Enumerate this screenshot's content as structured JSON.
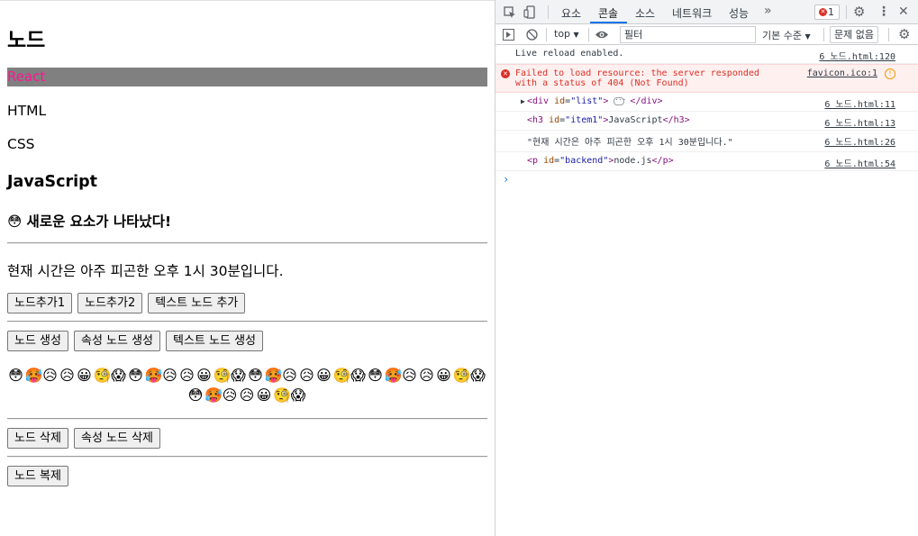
{
  "page": {
    "title": "노드",
    "list_items": [
      "React",
      "HTML",
      "CSS"
    ],
    "item1": "JavaScript",
    "new_element": "😳 새로운 요소가 나타났다!",
    "time_text": "현재 시간은 아주 피곤한 오후 1시 30분입니다.",
    "buttons_row1": [
      "노드추가1",
      "노드추가2",
      "텍스트 노드 추가"
    ],
    "buttons_row2": [
      "노드 생성",
      "속성 노드 생성",
      "텍스트 노드 생성"
    ],
    "emojis": "😳🥵😥😥😀🧐😱😳🥵😥😥😀🧐😱😳🥵😥😥😀🧐😱😳🥵😥😥😀🧐😱😳🥵😥😥😀🧐😱",
    "buttons_row3": [
      "노드 삭제",
      "속성 노드 삭제"
    ],
    "buttons_row4": [
      "노드 복제"
    ]
  },
  "devtools": {
    "tabs": [
      "요소",
      "콘솔",
      "소스",
      "네트워크",
      "성능"
    ],
    "active_tab": "콘솔",
    "more_tabs": "»",
    "error_count": "1",
    "context": "top",
    "filter_placeholder": "필터",
    "level": "기본 수준",
    "issues": "문제 없음",
    "console": {
      "live_reload": {
        "text": "Live reload enabled.",
        "src": "6 노드.html:120"
      },
      "error": {
        "text": "Failed to load resource: the server responded with a status of 404 (Not Found)",
        "src": "favicon.ico:1"
      },
      "div_log": {
        "tag_open": "<div",
        "attr": "id",
        "value": "\"list\"",
        "close": "</div>",
        "src": "6 노드.html:11"
      },
      "h3_log": {
        "tag_open": "<h3",
        "attr": "id",
        "value": "\"item1\"",
        "content": "JavaScript",
        "close": "</h3>",
        "src": "6 노드.html:13"
      },
      "string_log": {
        "text": "\"현재 시간은 아주 피곤한 오후 1시 30분입니다.\"",
        "src": "6 노드.html:26"
      },
      "p_log": {
        "tag_open": "<p",
        "attr": "id",
        "value": "\"backend\"",
        "content": "node.js",
        "close": "</p>",
        "src": "6 노드.html:54"
      },
      "prompt": "›"
    }
  }
}
